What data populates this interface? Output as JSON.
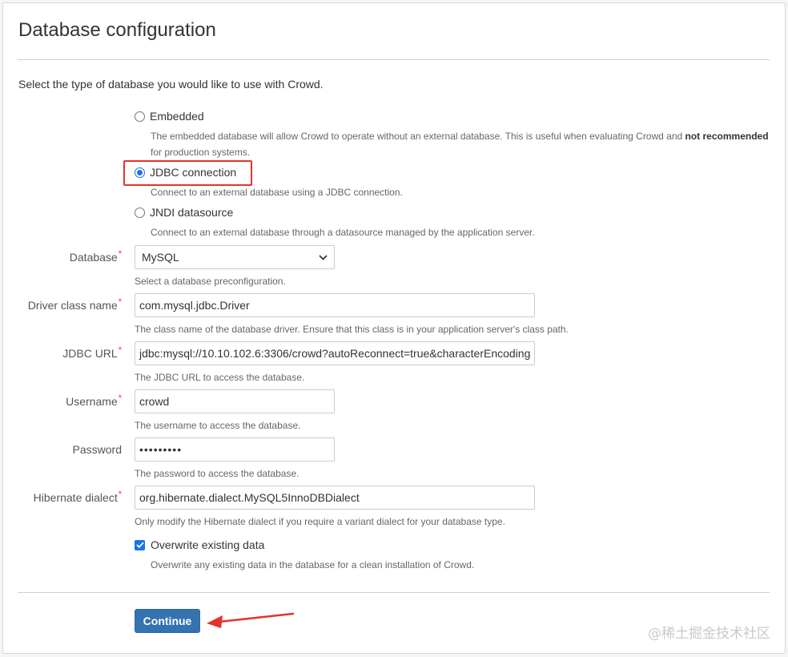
{
  "page": {
    "title": "Database configuration",
    "intro": "Select the type of database you would like to use with Crowd."
  },
  "options": {
    "embedded": {
      "label": "Embedded",
      "help_prefix": "The embedded database will allow Crowd to operate without an external database. This is useful when evaluating Crowd and ",
      "help_strong": "not recommended",
      "help_suffix": "for production systems.",
      "selected": false
    },
    "jdbc": {
      "label": "JDBC connection",
      "help": "Connect to an external database using a JDBC connection.",
      "selected": true
    },
    "jndi": {
      "label": "JNDI datasource",
      "help": "Connect to an external database through a datasource managed by the application server.",
      "selected": false
    }
  },
  "form": {
    "database": {
      "label": "Database",
      "required_mark": "*",
      "value": "MySQL",
      "help": "Select a database preconfiguration."
    },
    "driver": {
      "label": "Driver class name",
      "required_mark": "*",
      "value": "com.mysql.jdbc.Driver",
      "help": "The class name of the database driver. Ensure that this class is in your application server's class path."
    },
    "jdbc_url": {
      "label": "JDBC URL",
      "required_mark": "*",
      "value": "jdbc:mysql://10.10.102.6:3306/crowd?autoReconnect=true&characterEncoding",
      "help": "The JDBC URL to access the database."
    },
    "username": {
      "label": "Username",
      "required_mark": "*",
      "value": "crowd",
      "help": "The username to access the database."
    },
    "password": {
      "label": "Password",
      "value": "•••••••••",
      "help": "The password to access the database."
    },
    "dialect": {
      "label": "Hibernate dialect",
      "required_mark": "*",
      "value": "org.hibernate.dialect.MySQL5InnoDBDialect",
      "help": "Only modify the Hibernate dialect if you require a variant dialect for your database type."
    },
    "overwrite": {
      "label": "Overwrite existing data",
      "checked": true,
      "help": "Overwrite any existing data in the database for a clean installation of Crowd."
    }
  },
  "actions": {
    "continue_label": "Continue"
  },
  "watermark": "@稀土掘金技术社区",
  "colors": {
    "primary_button": "#3572b0",
    "required_mark": "#d04437",
    "annotation_red": "#e5322d",
    "radio_checked": "#1a73e8"
  }
}
